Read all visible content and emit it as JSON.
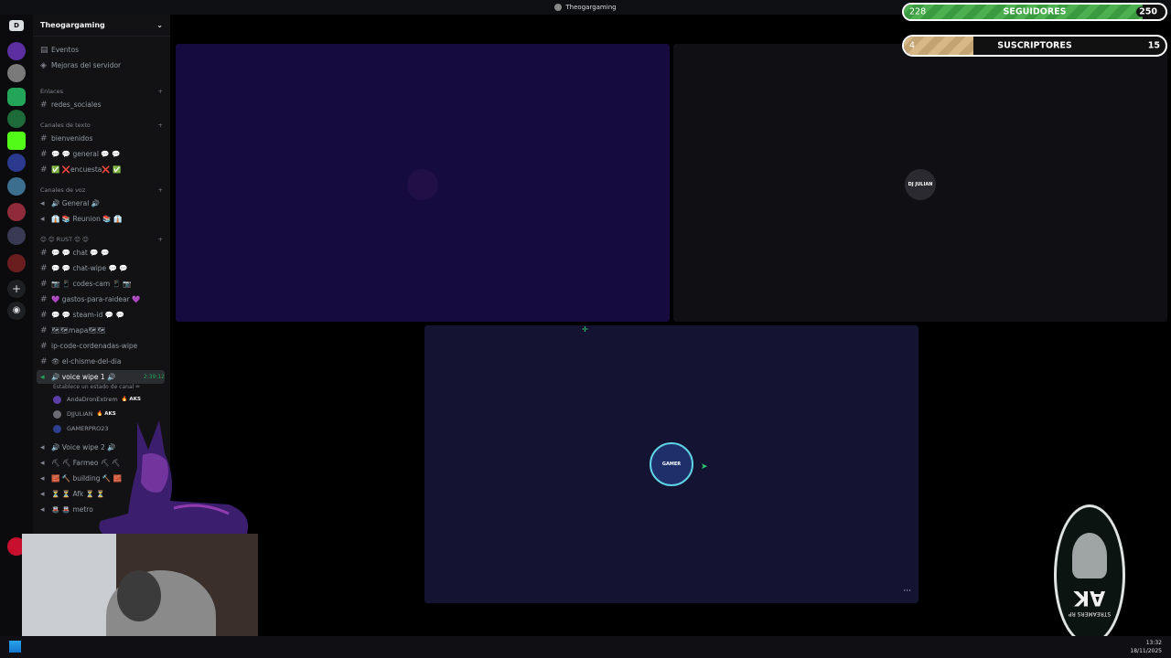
{
  "window": {
    "title": "Theogargaming"
  },
  "server": {
    "name": "Theogargaming"
  },
  "sidebar": {
    "top_items": [
      "Eventos",
      "Mejoras del servidor"
    ],
    "categories": {
      "enlaces": "Enlaces",
      "texto": "Canales de texto",
      "voz": "Canales de voz",
      "rust": "😊 😊 RUST 😊 😊"
    },
    "channels": {
      "redes": "redes_sociales",
      "bienvenidos": "bienvenidos",
      "general": "💬 💬 general 💬 💬",
      "encuesta": "✅ ❌encuesta❌ ✅",
      "v_general": "🔊 General 🔊",
      "v_reunion": "👔 📚 Reunion 📚 👔",
      "chat": "💬 💬 chat 💬 💬",
      "chat_wipe": "💬 💬 chat-wipe 💬 💬",
      "codes_cam": "📷 📱 codes-cam 📱 📷",
      "gastos": "💜 gastos-para-raidear 💜",
      "steam": "💬 💬 steam-id 💬 💬",
      "mapa": "🗺🗺mapa🗺🗺",
      "ipcode": "ip-code-cordenadas-wipe",
      "chisme": "👁 el-chisme-del-dia",
      "voice_wipe_1": "🔊 voice wipe 1 🔊",
      "voice_wipe_1_timer": "2:39:12",
      "voice_wipe_1_status": "Establece un estado de canal ✏",
      "voice_wipe_2": "🔊 Voice wipe 2 🔊",
      "farmeo": "⛏ ⛏ Farmeo ⛏ ⛏",
      "building": "🧱 🔨 building 🔨 🧱",
      "afk": "⏳ ⏳ Afk ⏳ ⏳",
      "metro": "🚇 🚇 metro"
    },
    "members": [
      {
        "name": "AndaDronExtrem",
        "tag": "🔥 AKS",
        "color": "#5b3fa8"
      },
      {
        "name": "DJJULIAN",
        "tag": "🔥 AKS",
        "color": "#6b6b73"
      },
      {
        "name": "GAMERPRO23",
        "tag": "",
        "color": "#2d3f8f"
      }
    ]
  },
  "tiles": [
    {
      "label": "",
      "color": "#150b3e"
    },
    {
      "label": "DJ JULIAN",
      "color": "#0f0f14"
    },
    {
      "label": "GAMER",
      "color": "#141332"
    }
  ],
  "overlay": {
    "followers": {
      "current": "228",
      "label": "SEGUIDORES",
      "goal": "250",
      "fraction": 0.912
    },
    "subscribers": {
      "current": "4",
      "label": "SUSCRIPTORES",
      "goal": "15",
      "fraction": 0.267
    }
  },
  "emblem": {
    "letters": "AK",
    "text": "STREAMERS RP"
  },
  "taskbar": {
    "time": "13:32",
    "date": "18/11/2025"
  },
  "tile_menu": "···"
}
